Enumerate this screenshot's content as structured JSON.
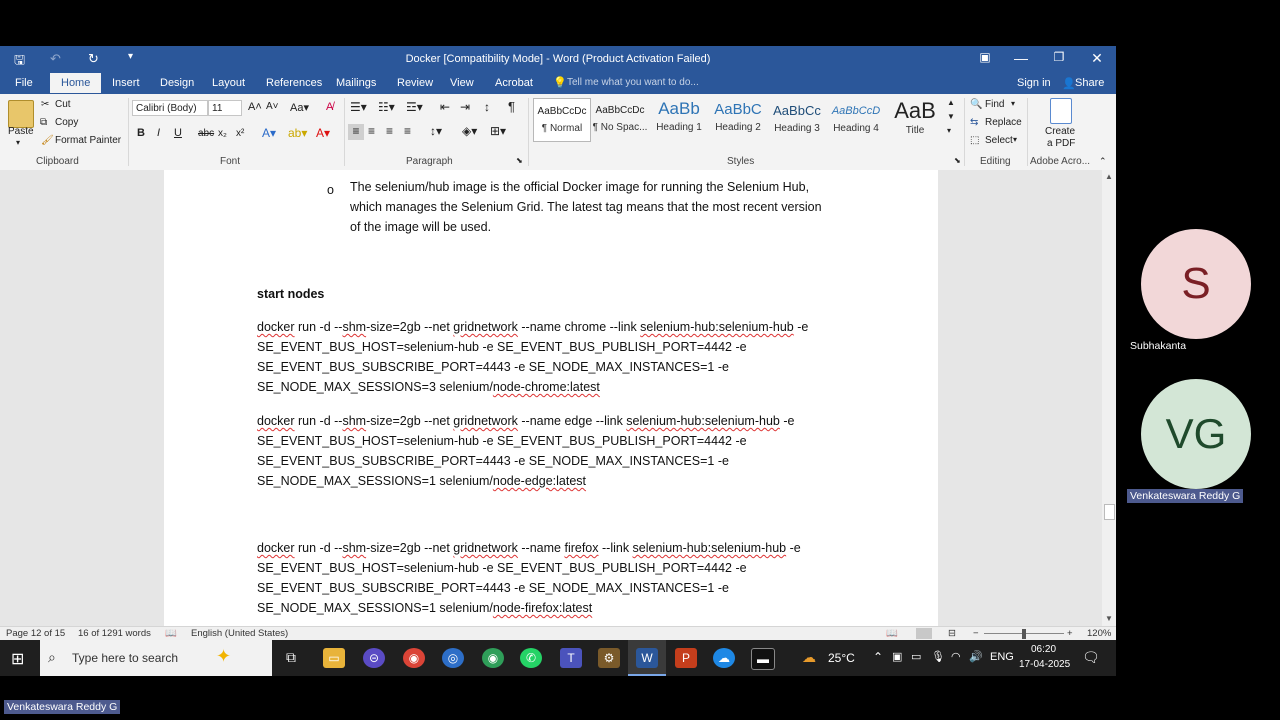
{
  "window": {
    "title": "Docker [Compatibility Mode] - Word (Product Activation Failed)"
  },
  "tabs": [
    "File",
    "Home",
    "Insert",
    "Design",
    "Layout",
    "References",
    "Mailings",
    "Review",
    "View",
    "Acrobat"
  ],
  "tell_me": "Tell me what you want to do...",
  "account": {
    "sign_in": "Sign in",
    "share": "Share"
  },
  "ribbon": {
    "clipboard": {
      "paste": "Paste",
      "cut": "Cut",
      "copy": "Copy",
      "format_painter": "Format Painter",
      "label": "Clipboard"
    },
    "font": {
      "name": "Calibri (Body)",
      "size": "11",
      "label": "Font",
      "bold": "B",
      "italic": "I",
      "underline": "U",
      "strike": "abc",
      "sub": "x₂",
      "sup": "x²"
    },
    "paragraph": {
      "label": "Paragraph"
    },
    "styles": {
      "label": "Styles",
      "items": [
        {
          "preview": "AaBbCcDc",
          "name": "¶ Normal"
        },
        {
          "preview": "AaBbCcDc",
          "name": "¶ No Spac..."
        },
        {
          "preview": "AaBb",
          "name": "Heading 1"
        },
        {
          "preview": "AaBbC",
          "name": "Heading 2"
        },
        {
          "preview": "AaBbCc",
          "name": "Heading 3"
        },
        {
          "preview": "AaBbCcD",
          "name": "Heading 4"
        },
        {
          "preview": "AaB",
          "name": "Title"
        }
      ]
    },
    "editing": {
      "label": "Editing",
      "find": "Find",
      "replace": "Replace",
      "select": "Select"
    },
    "acrobat": {
      "label": "Adobe Acro...",
      "create_pdf_1": "Create",
      "create_pdf_2": "a PDF"
    }
  },
  "document": {
    "bullet": "o",
    "intro_lines": [
      "The selenium/hub image is the official Docker image for running the Selenium Hub,",
      "which manages the Selenium Grid. The latest tag means that the most recent version",
      "of the image will be used."
    ],
    "heading": "start nodes",
    "chrome": {
      "l1a": "docker",
      "l1b": " run -d --",
      "l1c": "shm",
      "l1d": "-size=2gb --net ",
      "l1e": "gridnetwork",
      "l1f": " --name chrome --link ",
      "l1g": "selenium-hub:selenium-hub",
      "l1h": " -e",
      "l2": "SE_EVENT_BUS_HOST=selenium-hub -e SE_EVENT_BUS_PUBLISH_PORT=4442 -e",
      "l3": "SE_EVENT_BUS_SUBSCRIBE_PORT=4443 -e SE_NODE_MAX_INSTANCES=1 -e",
      "l4a": "SE_NODE_MAX_SESSIONS=3 selenium/",
      "l4b": "node-chrome:latest"
    },
    "edge": {
      "l1a": "docker",
      "l1b": " run -d --",
      "l1c": "shm",
      "l1d": "-size=2gb --net ",
      "l1e": "gridnetwork",
      "l1f": " --name edge --link ",
      "l1g": "selenium-hub:selenium-hub",
      "l1h": " -e",
      "l2": "SE_EVENT_BUS_HOST=selenium-hub -e SE_EVENT_BUS_PUBLISH_PORT=4442 -e",
      "l3": "SE_EVENT_BUS_SUBSCRIBE_PORT=4443 -e SE_NODE_MAX_INSTANCES=1 -e",
      "l4a": "SE_NODE_MAX_SESSIONS=1 selenium/",
      "l4b": "node-edge:latest"
    },
    "firefox": {
      "l1a": "docker",
      "l1b": " run -d --",
      "l1c": "shm",
      "l1d": "-size=2gb --net ",
      "l1e": "gridnetwork",
      "l1f": " --name ",
      "l1f2": "firefox",
      "l1f3": " --link ",
      "l1g": "selenium-hub:selenium-hub",
      "l1h": " -e",
      "l2": "SE_EVENT_BUS_HOST=selenium-hub -e SE_EVENT_BUS_PUBLISH_PORT=4442 -e",
      "l3": "SE_EVENT_BUS_SUBSCRIBE_PORT=4443 -e SE_NODE_MAX_INSTANCES=1 -e",
      "l4a": "SE_NODE_MAX_SESSIONS=1 selenium/",
      "l4b": "node-firefox:latest"
    }
  },
  "status": {
    "page": "Page 12 of 15",
    "words": "16 of 1291 words",
    "language": "English (United States)",
    "zoom": "120%",
    "zoom_minus": "−",
    "zoom_plus": "+"
  },
  "taskbar": {
    "search_placeholder": "Type here to search",
    "weather": "25°C",
    "lang": "ENG",
    "time": "06:20",
    "date": "17-04-2025"
  },
  "participants": [
    {
      "initials": "S",
      "name": "Subhakanta",
      "bg": "#f2d7d8",
      "fg": "#7a1f25"
    },
    {
      "initials": "VG",
      "name": "Venkateswara Reddy G",
      "bg": "#d3e6d6",
      "fg": "#1f4a2c"
    }
  ],
  "presenter_label": "Venkateswara Reddy G"
}
